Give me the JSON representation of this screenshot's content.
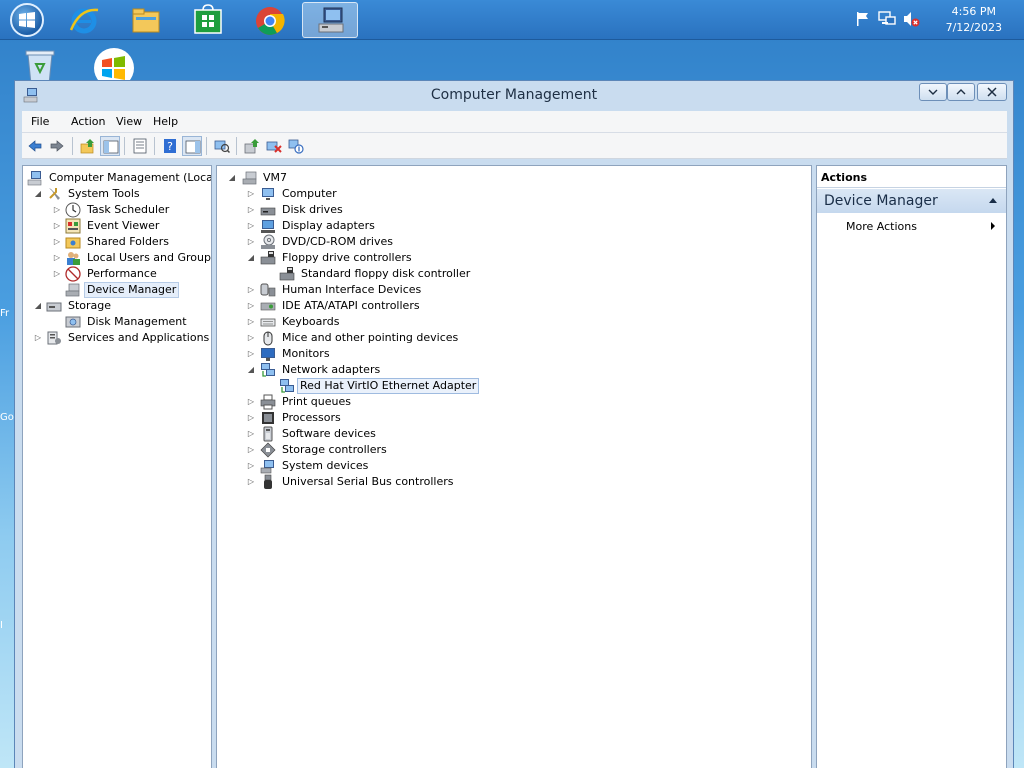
{
  "taskbar": {
    "clock_time": "4:56 PM",
    "clock_date": "7/12/2023",
    "apps": [
      "internet-explorer-icon",
      "file-explorer-icon",
      "store-icon",
      "chrome-icon",
      "computer-management-icon"
    ]
  },
  "desktop": {
    "edge_texts": [
      "Fr",
      "Go",
      "I"
    ]
  },
  "window": {
    "title": "Computer Management"
  },
  "menu": {
    "items": [
      "File",
      "Action",
      "View",
      "Help"
    ]
  },
  "left_tree": {
    "root": "Computer Management (Local)",
    "system_tools": "System Tools",
    "task_scheduler": "Task Scheduler",
    "event_viewer": "Event Viewer",
    "shared_folders": "Shared Folders",
    "local_users": "Local Users and Groups",
    "performance": "Performance",
    "device_manager": "Device Manager",
    "storage": "Storage",
    "disk_management": "Disk Management",
    "services": "Services and Applications"
  },
  "device_tree": {
    "root": "VM7",
    "computer": "Computer",
    "disk_drives": "Disk drives",
    "display_adapters": "Display adapters",
    "dvd": "DVD/CD-ROM drives",
    "floppy_controllers": "Floppy drive controllers",
    "floppy_std": "Standard floppy disk controller",
    "hid": "Human Interface Devices",
    "ide": "IDE ATA/ATAPI controllers",
    "keyboards": "Keyboards",
    "mice": "Mice and other pointing devices",
    "monitors": "Monitors",
    "network_adapters": "Network adapters",
    "virtio": "Red Hat VirtIO Ethernet Adapter",
    "print_queues": "Print queues",
    "processors": "Processors",
    "software_devices": "Software devices",
    "storage_controllers": "Storage controllers",
    "system_devices": "System devices",
    "usb": "Universal Serial Bus controllers"
  },
  "actions_pane": {
    "header": "Actions",
    "group": "Device Manager",
    "more_actions": "More Actions"
  },
  "colors": {
    "taskbar": "#2a72bf",
    "window_frame": "#c9dcef",
    "selection": "#e5eefa"
  }
}
